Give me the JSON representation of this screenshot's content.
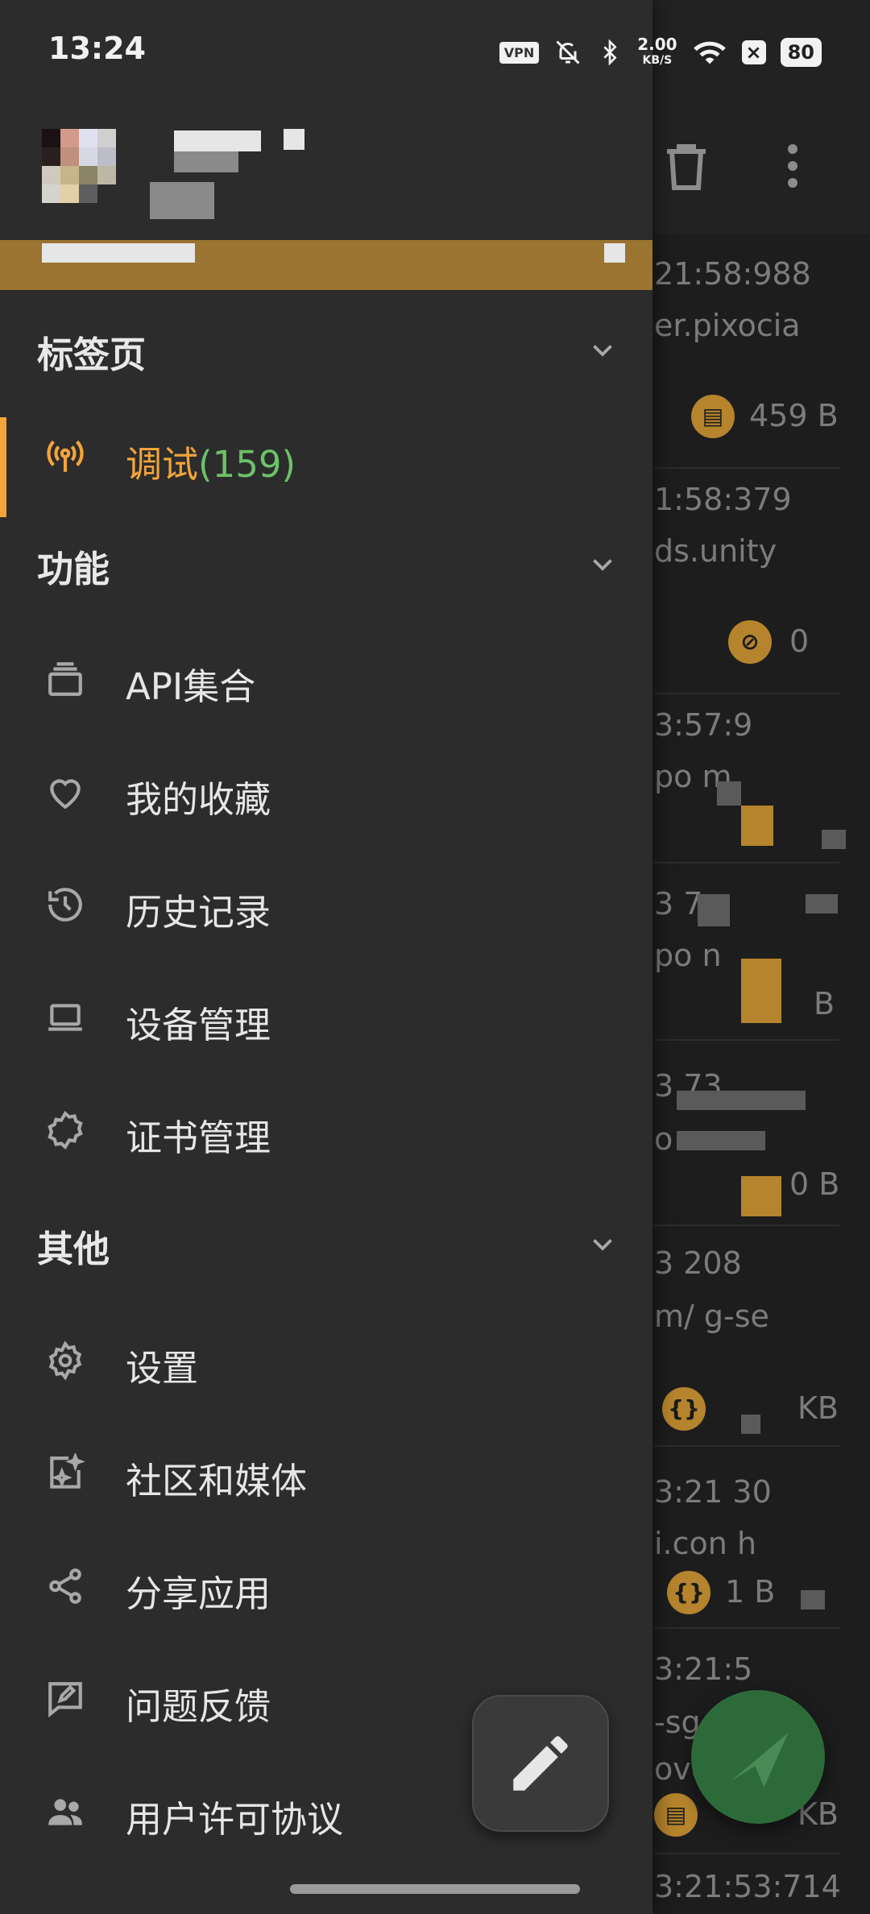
{
  "status_bar": {
    "time": "13:24",
    "net_speed_value": "2.00",
    "net_speed_unit": "KB/S",
    "battery": "80",
    "vpn_label": "VPN",
    "icons": [
      "vpn-icon",
      "mute-bell-icon",
      "bluetooth-icon",
      "wifi-icon",
      "close-box-icon",
      "battery-icon"
    ]
  },
  "background_app": {
    "rows": [
      {
        "time": "21:58:988",
        "host": "er.pixocia",
        "size": "459 B",
        "badge": "file-icon"
      },
      {
        "time": "1:58:379",
        "host": "ds.unity",
        "size": "0",
        "badge": "link-off-icon"
      },
      {
        "time": "3:57:9",
        "host": "po m",
        "size": "",
        "badge": "user-icon"
      },
      {
        "time": "3 7",
        "host": "po n",
        "size": "B",
        "badge": ""
      },
      {
        "time": "3 73",
        "host": "o",
        "size": "0 B",
        "badge": ""
      },
      {
        "time": "3 208",
        "host": "m/ g-se",
        "size": "KB",
        "badge": "json-icon"
      },
      {
        "time": "3:21 30",
        "host": "i.con h",
        "size": "1 B",
        "badge": "json-icon"
      },
      {
        "time": "3:21:5",
        "host": "-sg i",
        "host2": "ove .",
        "size": "KB",
        "badge": "file-icon"
      },
      {
        "time": "3:21:53:714",
        "host": "",
        "size": "",
        "badge": ""
      }
    ],
    "toolbar_icons": [
      "crop-icon",
      "refresh-icon",
      "delete-icon",
      "more-vertical-icon"
    ]
  },
  "drawer": {
    "sections": {
      "tabs": {
        "title": "标签页"
      },
      "features": {
        "title": "功能"
      },
      "other": {
        "title": "其他"
      }
    },
    "active_item": {
      "label": "调试",
      "count": "(159)",
      "icon": "antenna-icon"
    },
    "features_items": [
      {
        "label": "API集合",
        "icon": "collection-icon"
      },
      {
        "label": "我的收藏",
        "icon": "heart-icon"
      },
      {
        "label": "历史记录",
        "icon": "history-icon"
      },
      {
        "label": "设备管理",
        "icon": "laptop-icon"
      },
      {
        "label": "证书管理",
        "icon": "certificate-icon"
      }
    ],
    "other_items": [
      {
        "label": "设置",
        "icon": "gear-icon"
      },
      {
        "label": "社区和媒体",
        "icon": "community-icon"
      },
      {
        "label": "分享应用",
        "icon": "share-icon"
      },
      {
        "label": "问题反馈",
        "icon": "feedback-icon"
      },
      {
        "label": "用户许可协议",
        "icon": "people-icon"
      }
    ]
  },
  "colors": {
    "accent": "#f3a43a",
    "count_green": "#6cc26a",
    "drawer_bg": "#2c2c2c",
    "header_band": "#9a7430",
    "fab_green": "#2d6a3a"
  }
}
